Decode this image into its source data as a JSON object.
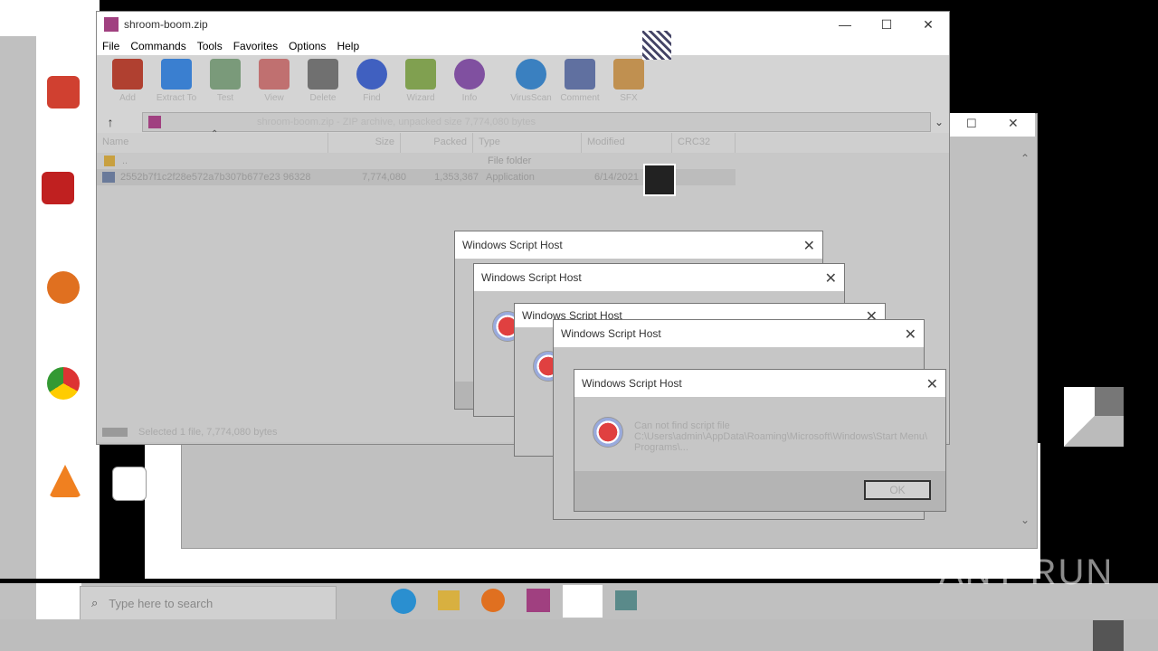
{
  "winrar": {
    "title": "shroom-boom.zip",
    "menu": [
      "File",
      "Commands",
      "Tools",
      "Favorites",
      "Options",
      "Help"
    ],
    "toolbar": [
      {
        "label": "Add",
        "icon": "archive-books-icon",
        "color": "#b04030"
      },
      {
        "label": "Extract To",
        "icon": "folder-icon",
        "color": "#3a7fd0"
      },
      {
        "label": "Test",
        "icon": "clipboard-check-icon",
        "color": "#7a9a7a"
      },
      {
        "label": "View",
        "icon": "open-book-icon",
        "color": "#c07070"
      },
      {
        "label": "Delete",
        "icon": "trash-icon",
        "color": "#707070"
      },
      {
        "label": "Find",
        "icon": "magnifier-icon",
        "color": "#4060c0"
      },
      {
        "label": "Wizard",
        "icon": "magic-wand-icon",
        "color": "#80a050"
      },
      {
        "label": "Info",
        "icon": "info-icon",
        "color": "#8050a0"
      },
      {
        "label": "VirusScan",
        "icon": "globe-icon",
        "color": "#3a80c0"
      },
      {
        "label": "Comment",
        "icon": "comment-icon",
        "color": "#6070a0"
      },
      {
        "label": "SFX",
        "icon": "box-icon",
        "color": "#c09050"
      }
    ],
    "address_text": "shroom-boom.zip - ZIP archive, unpacked size 7,774,080 bytes",
    "columns": [
      "Name",
      "Size",
      "Packed",
      "Type",
      "Modified",
      "CRC32"
    ],
    "rows": [
      {
        "name": "..",
        "size": "",
        "packed": "",
        "type": "File folder",
        "modified": "",
        "crc": ""
      },
      {
        "name": "2552b7f1c2f28e572a7b307b677e23 96328",
        "size": "7,774,080",
        "packed": "1,353,367",
        "type": "Application",
        "modified": "6/14/2021",
        "crc": ""
      }
    ],
    "status": "Selected 1 file, 7,774,080 bytes"
  },
  "dialogs": {
    "title": "Windows Script Host",
    "message_line1": "Can not find script file",
    "message_line2": "C:\\Users\\admin\\AppData\\Roaming\\Microsoft\\Windows\\Start Menu\\",
    "message_line3": "Programs\\...",
    "ok": "OK"
  },
  "window_controls": {
    "minimize": "—",
    "maximize": "☐",
    "close": "✕"
  },
  "taskbar": {
    "search_placeholder": "Type here to search",
    "watermark": "ANY RUN"
  },
  "colors": {
    "background": "#000000",
    "window_gray": "#c4c4c4",
    "titlebar": "#ffffff"
  }
}
